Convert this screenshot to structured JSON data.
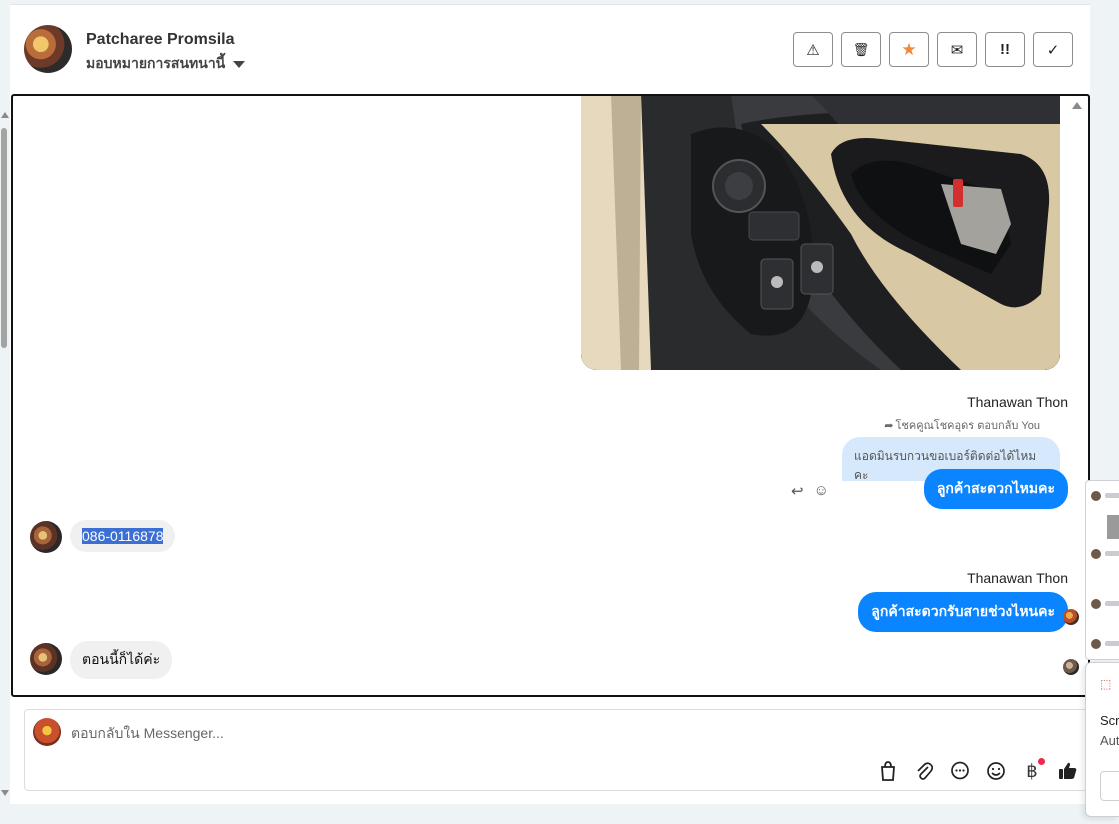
{
  "header": {
    "contact_name": "Patcharee Promsila",
    "assign_label": "มอบหมายการสนทนานี้",
    "toolbar": [
      {
        "name": "report-button",
        "icon": "⚠"
      },
      {
        "name": "delete-button",
        "icon": "🗑"
      },
      {
        "name": "star-button",
        "icon": "★"
      },
      {
        "name": "mark-unread-button",
        "icon": "✉"
      },
      {
        "name": "priority-button",
        "icon": "!!"
      },
      {
        "name": "done-button",
        "icon": "✓"
      }
    ]
  },
  "chat": {
    "msg1": {
      "sender": "Thanawan Thon",
      "reply_note": "โชคคูณโชคอุดร ตอบกลับ You",
      "quoted": "แอดมินรบกวนขอเบอร์ติดต่อได้ไหมคะ",
      "text": "ลูกค้าสะดวกไหมคะ"
    },
    "msg2": {
      "text": "086-0116878"
    },
    "msg3": {
      "sender": "Thanawan Thon",
      "text": "ลูกค้าสะดวกรับสายช่วงไหนคะ"
    },
    "msg4": {
      "text": "ตอนนี้ก็ได้ค่ะ"
    }
  },
  "composer": {
    "placeholder": "ตอบกลับใน Messenger..."
  },
  "toast": {
    "line1": "Scr",
    "line2": "Aut"
  },
  "colors": {
    "outgoing_bubble": "#0a84ff",
    "quoted_bubble": "#d6e8fb",
    "incoming_bubble": "#f0f0f0",
    "star": "#f0883e"
  }
}
